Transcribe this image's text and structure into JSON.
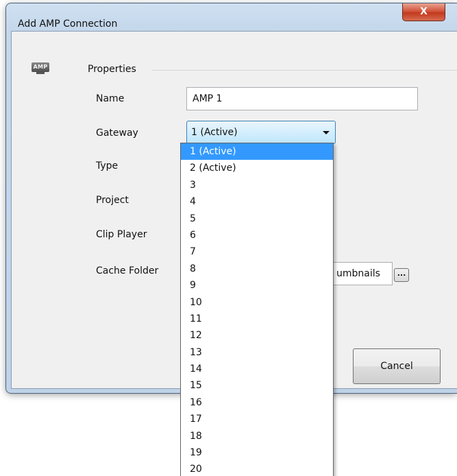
{
  "window": {
    "title": "Add AMP Connection",
    "close_glyph": "X"
  },
  "section": {
    "icon_label": "AMP",
    "title": "Properties"
  },
  "fields": {
    "name_label": "Name",
    "name_value": "AMP 1",
    "gateway_label": "Gateway",
    "gateway_value": "1 (Active)",
    "type_label": "Type",
    "project_label": "Project",
    "clip_player_label": "Clip Player",
    "cache_folder_label": "Cache Folder",
    "cache_folder_value_visible": "umbnails",
    "browse_label": "..."
  },
  "buttons": {
    "cancel_label": "Cancel"
  },
  "gateway_options": [
    "1 (Active)",
    "2 (Active)",
    "3",
    "4",
    "5",
    "6",
    "7",
    "8",
    "9",
    "10",
    "11",
    "12",
    "13",
    "14",
    "15",
    "16",
    "17",
    "18",
    "19",
    "20"
  ],
  "gateway_selected_index": 0,
  "colors": {
    "selection": "#3399ff",
    "close_button": "#c23a1f",
    "window_frame": "#c4d7eb"
  }
}
